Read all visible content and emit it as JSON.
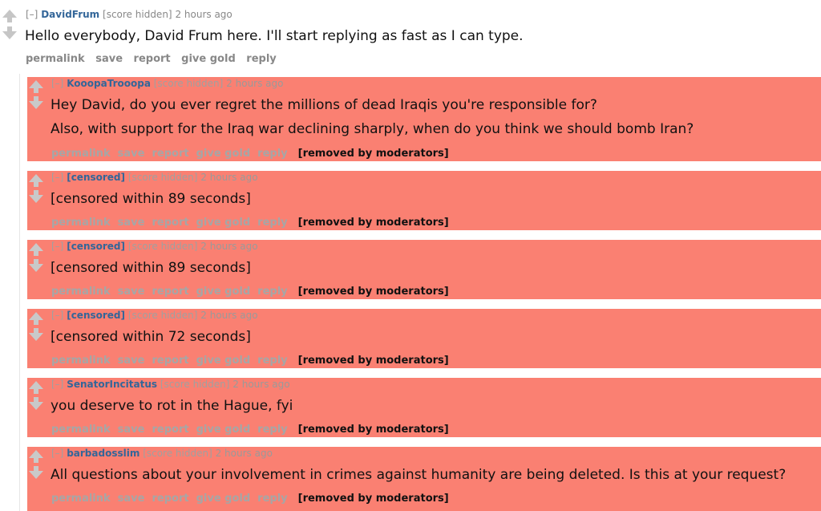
{
  "top_comment": {
    "expand": "[–]",
    "author": "DavidFrum",
    "score": "[score hidden]",
    "time": "2 hours ago",
    "body": "Hello everybody, David Frum here. I'll start replying as fast as I can type.",
    "buttons": [
      "permalink",
      "save",
      "report",
      "give gold",
      "reply"
    ]
  },
  "replies": [
    {
      "expand": "[–]",
      "author": "KooopaTrooopa",
      "score": "[score hidden]",
      "time": "2 hours ago",
      "body_lines": [
        "Hey David, do you ever regret the millions of dead Iraqis you're responsible for?",
        "Also, with support for the Iraq war declining sharply, when do you think we should bomb Iran?"
      ],
      "buttons": [
        "permalink",
        "save",
        "report",
        "give gold",
        "reply"
      ],
      "status": "[removed by moderators]"
    },
    {
      "expand": "[–]",
      "author": "[censored]",
      "score": "[score hidden]",
      "time": "2 hours ago",
      "body_lines": [
        "[censored within 89 seconds]"
      ],
      "buttons": [
        "permalink",
        "save",
        "report",
        "give gold",
        "reply"
      ],
      "status": "[removed by moderators]"
    },
    {
      "expand": "[–]",
      "author": "[censored]",
      "score": "[score hidden]",
      "time": "2 hours ago",
      "body_lines": [
        "[censored within 89 seconds]"
      ],
      "buttons": [
        "permalink",
        "save",
        "report",
        "give gold",
        "reply"
      ],
      "status": "[removed by moderators]"
    },
    {
      "expand": "[–]",
      "author": "[censored]",
      "score": "[score hidden]",
      "time": "2 hours ago",
      "body_lines": [
        "[censored within 72 seconds]"
      ],
      "buttons": [
        "permalink",
        "save",
        "report",
        "give gold",
        "reply"
      ],
      "status": "[removed by moderators]"
    },
    {
      "expand": "[–]",
      "author": "SenatorIncitatus",
      "score": "[score hidden]",
      "time": "2 hours ago",
      "body_lines": [
        "you deserve to rot in the Hague, fyi"
      ],
      "buttons": [
        "permalink",
        "save",
        "report",
        "give gold",
        "reply"
      ],
      "status": "[removed by moderators]"
    },
    {
      "expand": "[–]",
      "author": "barbadosslim",
      "score": "[score hidden]",
      "time": "2 hours ago",
      "body_lines": [
        "All questions about your involvement in crimes against humanity are being deleted. Is this at your request?"
      ],
      "buttons": [
        "permalink",
        "save",
        "report",
        "give gold",
        "reply"
      ],
      "status": "[removed by moderators]"
    }
  ],
  "colors": {
    "removed_background": "#fa8072",
    "author_link": "#336699",
    "meta_text": "#888888"
  }
}
